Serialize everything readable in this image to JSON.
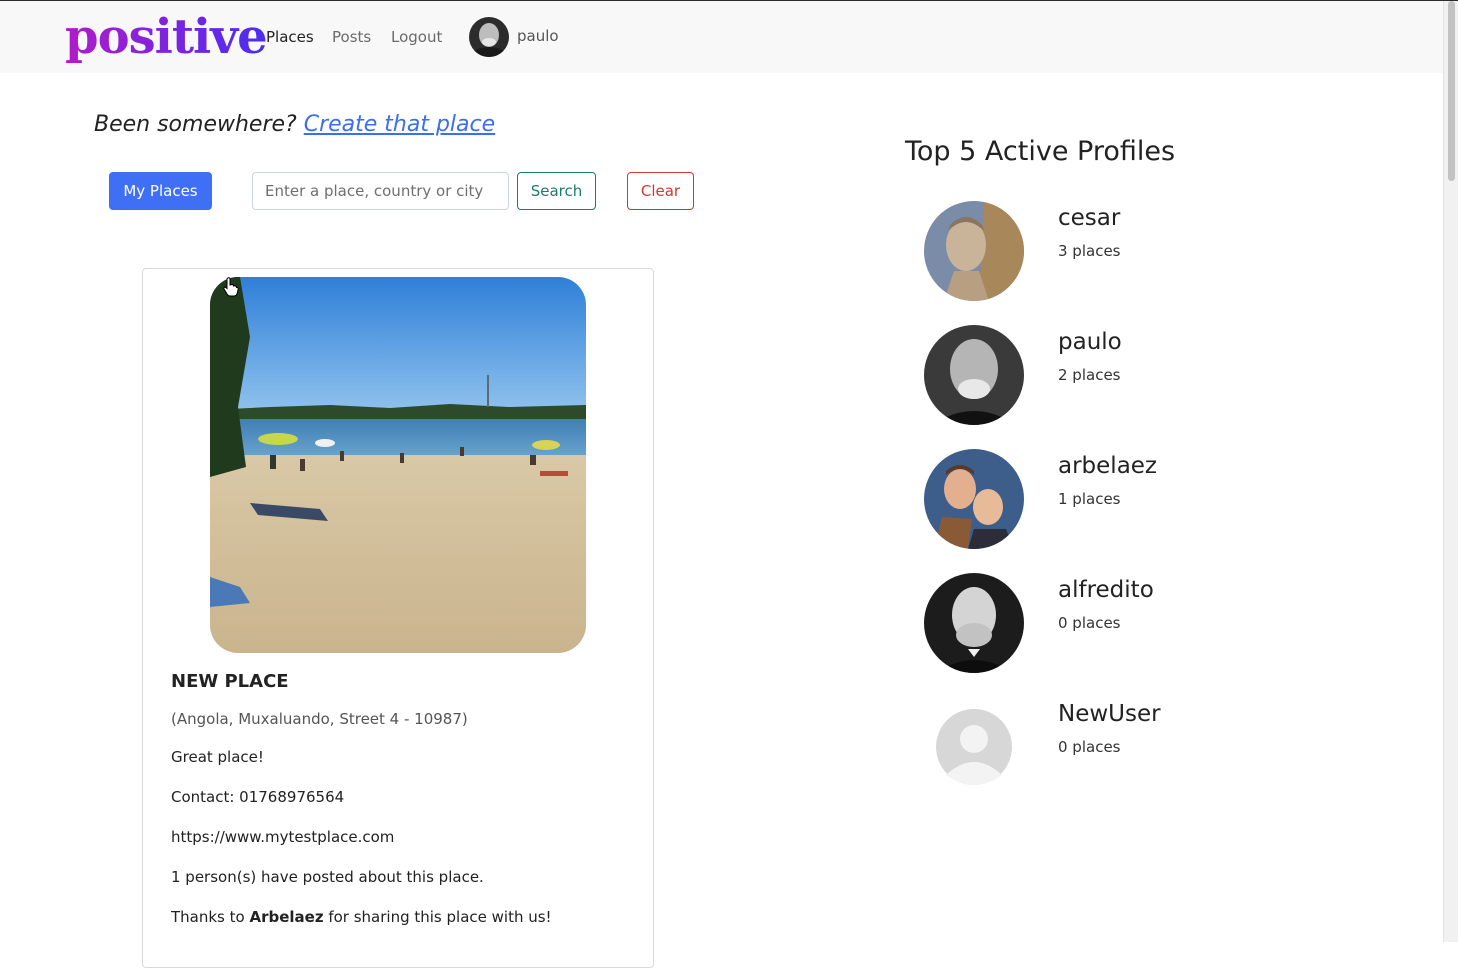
{
  "navbar": {
    "brand": "positive",
    "links": [
      "Places",
      "Posts",
      "Logout"
    ],
    "username": "paulo"
  },
  "prompt": {
    "text": "Been somewhere?",
    "link": "Create that place"
  },
  "toolbar": {
    "my_places": "My Places",
    "search_placeholder": "Enter a place, country or city",
    "search": "Search",
    "clear": "Clear"
  },
  "place_card": {
    "title": "NEW PLACE",
    "address": "(Angola, Muxaluando, Street 4 - 10987)",
    "description": "Great place!",
    "contact": "Contact: 01768976564",
    "website": "https://www.mytestplace.com",
    "posts_count": "1 person(s) have posted about this place.",
    "thanks_prefix": "Thanks to ",
    "thanks_user": "Arbelaez",
    "thanks_suffix": " for sharing this place with us!"
  },
  "top_profiles": {
    "heading": "Top 5 Active Profiles",
    "profiles": [
      {
        "name": "cesar",
        "count": "3 places"
      },
      {
        "name": "paulo",
        "count": "2 places"
      },
      {
        "name": "arbelaez",
        "count": "1 places"
      },
      {
        "name": "alfredito",
        "count": "0 places"
      },
      {
        "name": "NewUser",
        "count": "0 places"
      }
    ]
  },
  "colors": {
    "primary": "#3f6ff5",
    "success": "#1c7c6c",
    "danger": "#d0382c",
    "brand_gradient": [
      "#b01cc9",
      "#4a2ef0"
    ]
  }
}
